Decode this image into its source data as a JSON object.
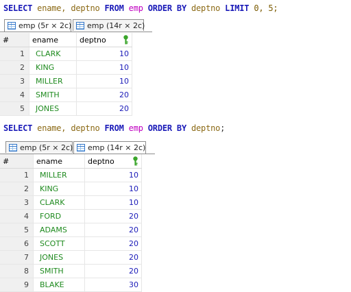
{
  "query1": {
    "select": "SELECT",
    "cols": " ename, deptno ",
    "from": "FROM",
    "table": " emp ",
    "orderby": "ORDER BY",
    "col": " deptno ",
    "limit": "LIMIT",
    "args": " 0, 5;"
  },
  "tabs1": [
    {
      "label": "emp (5r × 2c)",
      "active": true
    },
    {
      "label": "emp (14r × 2c)",
      "active": false
    }
  ],
  "grid1": {
    "headers": {
      "rownum": "#",
      "ename": "ename",
      "deptno": "deptno"
    },
    "rows": [
      {
        "n": "1",
        "ename": "CLARK",
        "deptno": "10"
      },
      {
        "n": "2",
        "ename": "KING",
        "deptno": "10"
      },
      {
        "n": "3",
        "ename": "MILLER",
        "deptno": "10"
      },
      {
        "n": "4",
        "ename": "SMITH",
        "deptno": "20"
      },
      {
        "n": "5",
        "ename": "JONES",
        "deptno": "20"
      }
    ]
  },
  "query2": {
    "select": "SELECT",
    "cols": " ename, deptno ",
    "from": "FROM",
    "table": " emp ",
    "orderby": "ORDER BY",
    "col": " deptno",
    "end": ";"
  },
  "tabs2": [
    {
      "label": "emp (5r × 2c)",
      "active": false
    },
    {
      "label": "emp (14r × 2c)",
      "active": true
    }
  ],
  "grid2": {
    "headers": {
      "rownum": "#",
      "ename": "ename",
      "deptno": "deptno"
    },
    "rows": [
      {
        "n": "1",
        "ename": "MILLER",
        "deptno": "10"
      },
      {
        "n": "2",
        "ename": "KING",
        "deptno": "10"
      },
      {
        "n": "3",
        "ename": "CLARK",
        "deptno": "10"
      },
      {
        "n": "4",
        "ename": "FORD",
        "deptno": "20"
      },
      {
        "n": "5",
        "ename": "ADAMS",
        "deptno": "20"
      },
      {
        "n": "6",
        "ename": "SCOTT",
        "deptno": "20"
      },
      {
        "n": "7",
        "ename": "JONES",
        "deptno": "20"
      },
      {
        "n": "8",
        "ename": "SMITH",
        "deptno": "20"
      },
      {
        "n": "9",
        "ename": "BLAKE",
        "deptno": "30"
      }
    ]
  },
  "colors": {
    "keyword": "#1a1ab8",
    "table": "#c000c0",
    "column": "#8b6914",
    "ename_text": "#1e8a1e",
    "deptno_text": "#1a1ab8",
    "key_icon": "#3aa52a"
  },
  "icons": {
    "tab": "table-grid-icon",
    "primary_key": "key-icon"
  }
}
